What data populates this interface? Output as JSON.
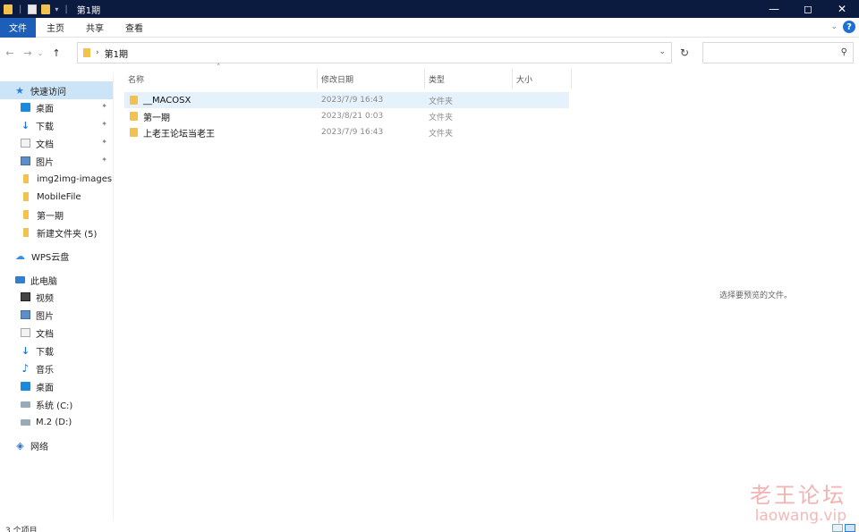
{
  "window": {
    "title": "第1期"
  },
  "ribbon": {
    "tabs": [
      "文件",
      "主页",
      "共享",
      "查看"
    ],
    "help_label": "?"
  },
  "address": {
    "crumb": "第1期"
  },
  "nav": {
    "quick_access": "快速访问",
    "quick_items": [
      {
        "label": "桌面",
        "icon": "desktop-icon",
        "pinned": true
      },
      {
        "label": "下载",
        "icon": "download-icon",
        "pinned": true
      },
      {
        "label": "文档",
        "icon": "document-icon",
        "pinned": true
      },
      {
        "label": "图片",
        "icon": "pictures-icon",
        "pinned": true
      },
      {
        "label": "img2img-images",
        "icon": "folder-icon",
        "pinned": false
      },
      {
        "label": "MobileFile",
        "icon": "folder-icon",
        "pinned": false
      },
      {
        "label": "第一期",
        "icon": "folder-icon",
        "pinned": false
      },
      {
        "label": "新建文件夹 (5)",
        "icon": "folder-icon",
        "pinned": false
      }
    ],
    "wps": "WPS云盘",
    "this_pc": "此电脑",
    "pc_items": [
      {
        "label": "视频",
        "icon": "video-icon"
      },
      {
        "label": "图片",
        "icon": "pictures-icon"
      },
      {
        "label": "文档",
        "icon": "document-icon"
      },
      {
        "label": "下载",
        "icon": "download-icon"
      },
      {
        "label": "音乐",
        "icon": "music-icon"
      },
      {
        "label": "桌面",
        "icon": "desktop-icon"
      },
      {
        "label": "系统 (C:)",
        "icon": "drive-icon"
      },
      {
        "label": "M.2 (D:)",
        "icon": "drive-icon"
      }
    ],
    "network": "网络"
  },
  "columns": {
    "name": "名称",
    "date": "修改日期",
    "type": "类型",
    "size": "大小"
  },
  "files": [
    {
      "name": "__MACOSX",
      "date": "2023/7/9 16:43",
      "type": "文件夹",
      "selected": true
    },
    {
      "name": "第一期",
      "date": "2023/8/21 0:03",
      "type": "文件夹",
      "selected": false
    },
    {
      "name": "上老王论坛当老王",
      "date": "2023/7/9 16:43",
      "type": "文件夹",
      "selected": false
    }
  ],
  "preview": {
    "message": "选择要预览的文件。"
  },
  "status": {
    "count": "3 个项目"
  },
  "watermark": {
    "title": "老王论坛",
    "url": "laowang.vip"
  },
  "colors": {
    "titlebar": "#0b1a3f",
    "file_tab": "#1d5fb8",
    "selection": "#cce4f7",
    "folder": "#f2c14e"
  }
}
